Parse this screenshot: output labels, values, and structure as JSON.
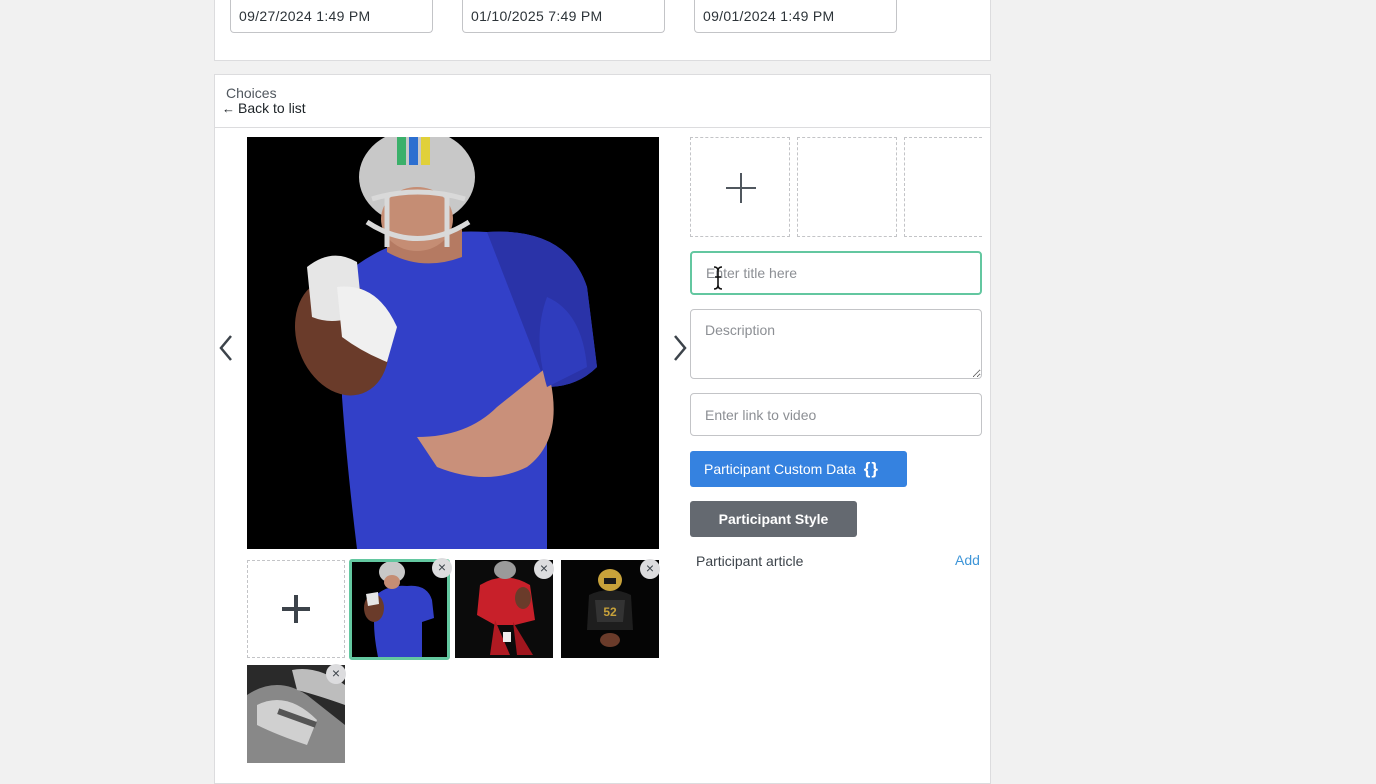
{
  "dates": {
    "field_1": "09/27/2024 1:49 PM",
    "field_2": "01/10/2025 7:49 PM",
    "field_3": "09/01/2024 1:49 PM"
  },
  "choices": {
    "title": "Choices",
    "back_arrow": "←",
    "back_label": "Back to list"
  },
  "editor": {
    "title_placeholder": "Enter title here",
    "description_placeholder": "Description",
    "video_placeholder": "Enter link to video",
    "custom_data_label": "Participant Custom Data",
    "custom_data_icon": "{}",
    "style_label": "Participant Style",
    "article_label": "Participant article",
    "article_add": "Add"
  },
  "gallery": {
    "remove_symbol": "×",
    "selected_index": 0,
    "thumbnails": [
      {
        "name": "football-player-blue-jersey"
      },
      {
        "name": "football-player-red-jersey"
      },
      {
        "name": "football-player-kneeling"
      },
      {
        "name": "football-gloves-closeup"
      }
    ]
  },
  "colors": {
    "accent_green": "#63c7a0",
    "primary_blue": "#3582e0",
    "secondary_gray": "#646970",
    "link_blue": "#3f96d8"
  }
}
